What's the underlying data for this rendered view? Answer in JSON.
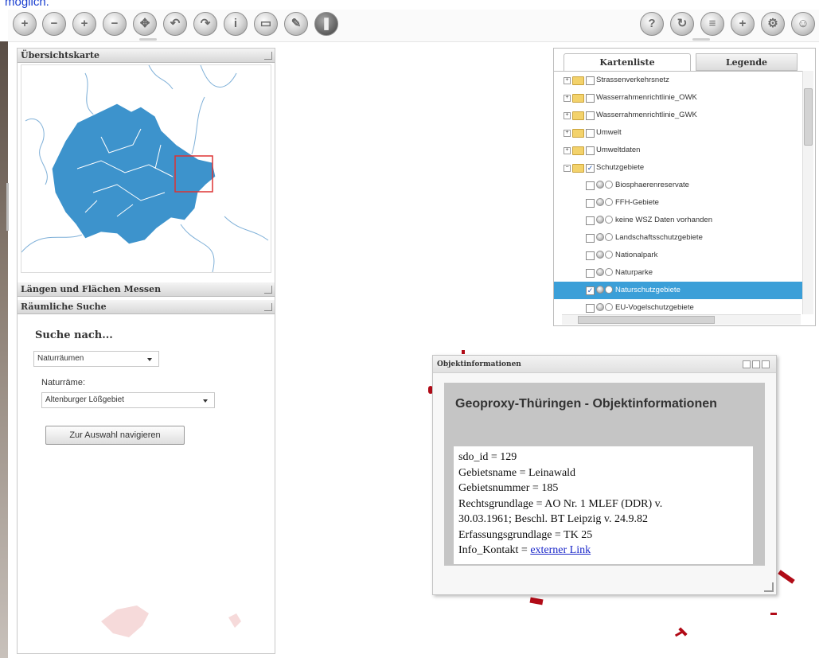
{
  "top_link": "möglich.",
  "toolbar": {
    "left_icons": [
      "zoom-in-icon",
      "zoom-out-icon",
      "plus-icon",
      "minus-icon",
      "pan-icon",
      "back-icon",
      "forward-icon",
      "info-icon",
      "print-icon",
      "pencil-icon",
      "pause-icon"
    ],
    "right_icons": [
      "help-icon",
      "refresh-icon",
      "layers-icon",
      "add-icon",
      "settings-icon",
      "user-icon"
    ]
  },
  "left_panel": {
    "overview_title": "Übersichtskarte",
    "measure_title": "Längen und Flächen Messen",
    "spatial_title": "Räumliche Suche",
    "search_heading": "Suche nach...",
    "search_type_value": "Naturräumen",
    "naturraum_label": "Naturräme:",
    "naturraum_value": "Altenburger Lößgebiet",
    "navigate_button": "Zur Auswahl navigieren"
  },
  "layer_panel": {
    "tab_list": "Kartenliste",
    "tab_legend": "Legende",
    "items": [
      {
        "label": "Strassenverkehrsnetz",
        "level": 0,
        "expand": "+",
        "checked": false
      },
      {
        "label": "Wasserrahmenrichtlinie_OWK",
        "level": 0,
        "expand": "+",
        "checked": false
      },
      {
        "label": "Wasserrahmenrichtlinie_GWK",
        "level": 0,
        "expand": "+",
        "checked": false
      },
      {
        "label": "Umwelt",
        "level": 0,
        "expand": "+",
        "checked": false
      },
      {
        "label": "Umweltdaten",
        "level": 0,
        "expand": "+",
        "checked": false
      },
      {
        "label": "Schutzgebiete",
        "level": 0,
        "expand": "−",
        "checked": true
      },
      {
        "label": "Biosphaerenreservate",
        "level": 1,
        "checked": false
      },
      {
        "label": "FFH-Gebiete",
        "level": 1,
        "checked": false
      },
      {
        "label": "keine WSZ Daten vorhanden",
        "level": 1,
        "checked": false
      },
      {
        "label": "Landschaftsschutzgebiete",
        "level": 1,
        "checked": false
      },
      {
        "label": "Nationalpark",
        "level": 1,
        "checked": false
      },
      {
        "label": "Naturparke",
        "level": 1,
        "checked": false
      },
      {
        "label": "Naturschutzgebiete",
        "level": 1,
        "checked": true,
        "selected": true
      },
      {
        "label": "EU-Vogelschutzgebiete",
        "level": 1,
        "checked": false
      }
    ]
  },
  "info_popup": {
    "window_title": "Objektinformationen",
    "heading": "Geoproxy-Thüringen - Objektinformationen",
    "line1": "sdo_id = 129",
    "line2": "Gebietsname = Leinawald",
    "line3": "Gebietsnummer = 185",
    "line4": "Rechtsgrundlage = AO Nr. 1 MLEF (DDR) v.",
    "line5": "30.03.1961; Beschl. BT Leipzig v. 24.9.82",
    "line6": "Erfassungsgrundlage = TK 25",
    "line7_prefix": "Info_Kontakt = ",
    "line7_link": "externer Link"
  },
  "colors": {
    "map_fill": "#3d93cc",
    "selection_blue": "#3b9fd8",
    "feature_red": "#b10b17"
  }
}
